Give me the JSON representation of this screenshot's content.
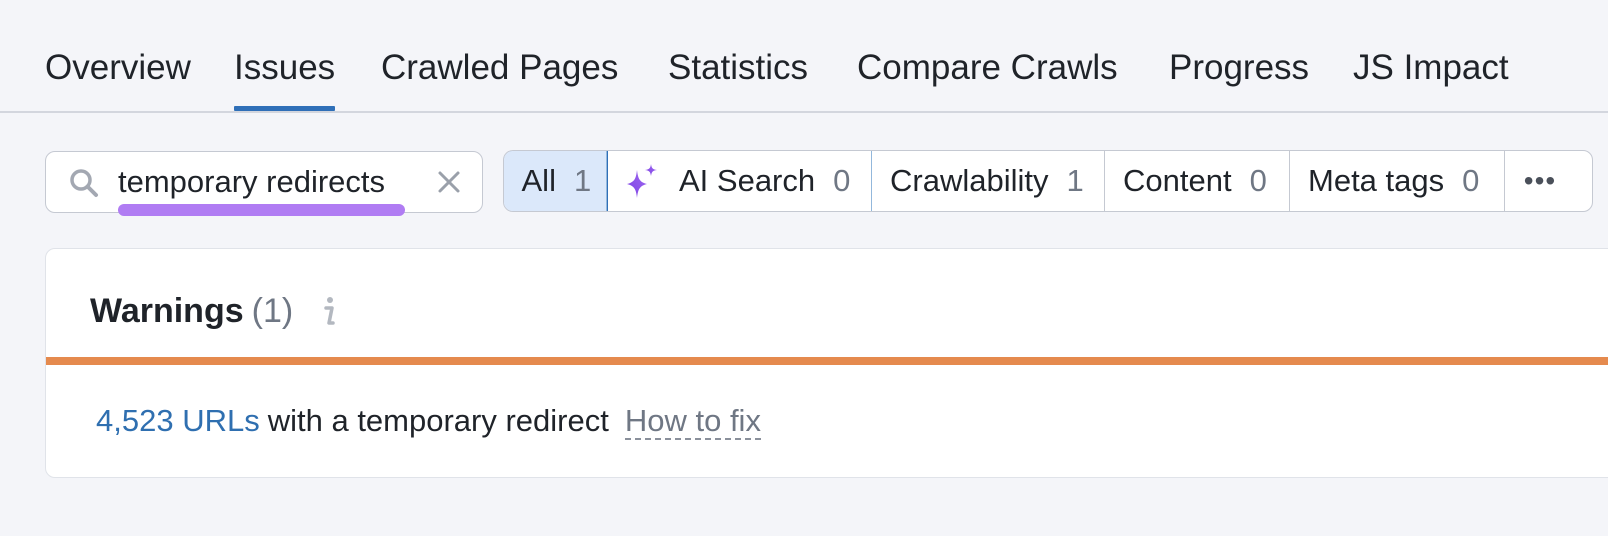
{
  "tabs": [
    {
      "label": "Overview",
      "active": false
    },
    {
      "label": "Issues",
      "active": true
    },
    {
      "label": "Crawled Pages",
      "active": false
    },
    {
      "label": "Statistics",
      "active": false
    },
    {
      "label": "Compare Crawls",
      "active": false
    },
    {
      "label": "Progress",
      "active": false
    },
    {
      "label": "JS Impact",
      "active": false
    }
  ],
  "search": {
    "value": "temporary redirects",
    "icon": "search-icon",
    "clear_icon": "close-icon"
  },
  "filters": {
    "all": {
      "label": "All",
      "count": "1"
    },
    "ai_search": {
      "label": "AI Search",
      "count": "0",
      "icon": "sparkle-icon"
    },
    "crawlability": {
      "label": "Crawlability",
      "count": "1"
    },
    "content": {
      "label": "Content",
      "count": "0"
    },
    "meta_tags": {
      "label": "Meta tags",
      "count": "0"
    },
    "more": {
      "label": "•••"
    }
  },
  "warnings": {
    "title": "Warnings",
    "count": "(1)",
    "info_icon": "info-icon",
    "issue": {
      "link_text": "4,523 URLs",
      "description": "with a temporary redirect",
      "how_to_fix": "How to fix"
    }
  },
  "colors": {
    "accent_blue": "#2f6fb8",
    "active_fill": "#dbe8fa",
    "search_highlight": "#b07cf3",
    "warning_stripe": "#e58a4e",
    "link": "#2f6fb0"
  }
}
